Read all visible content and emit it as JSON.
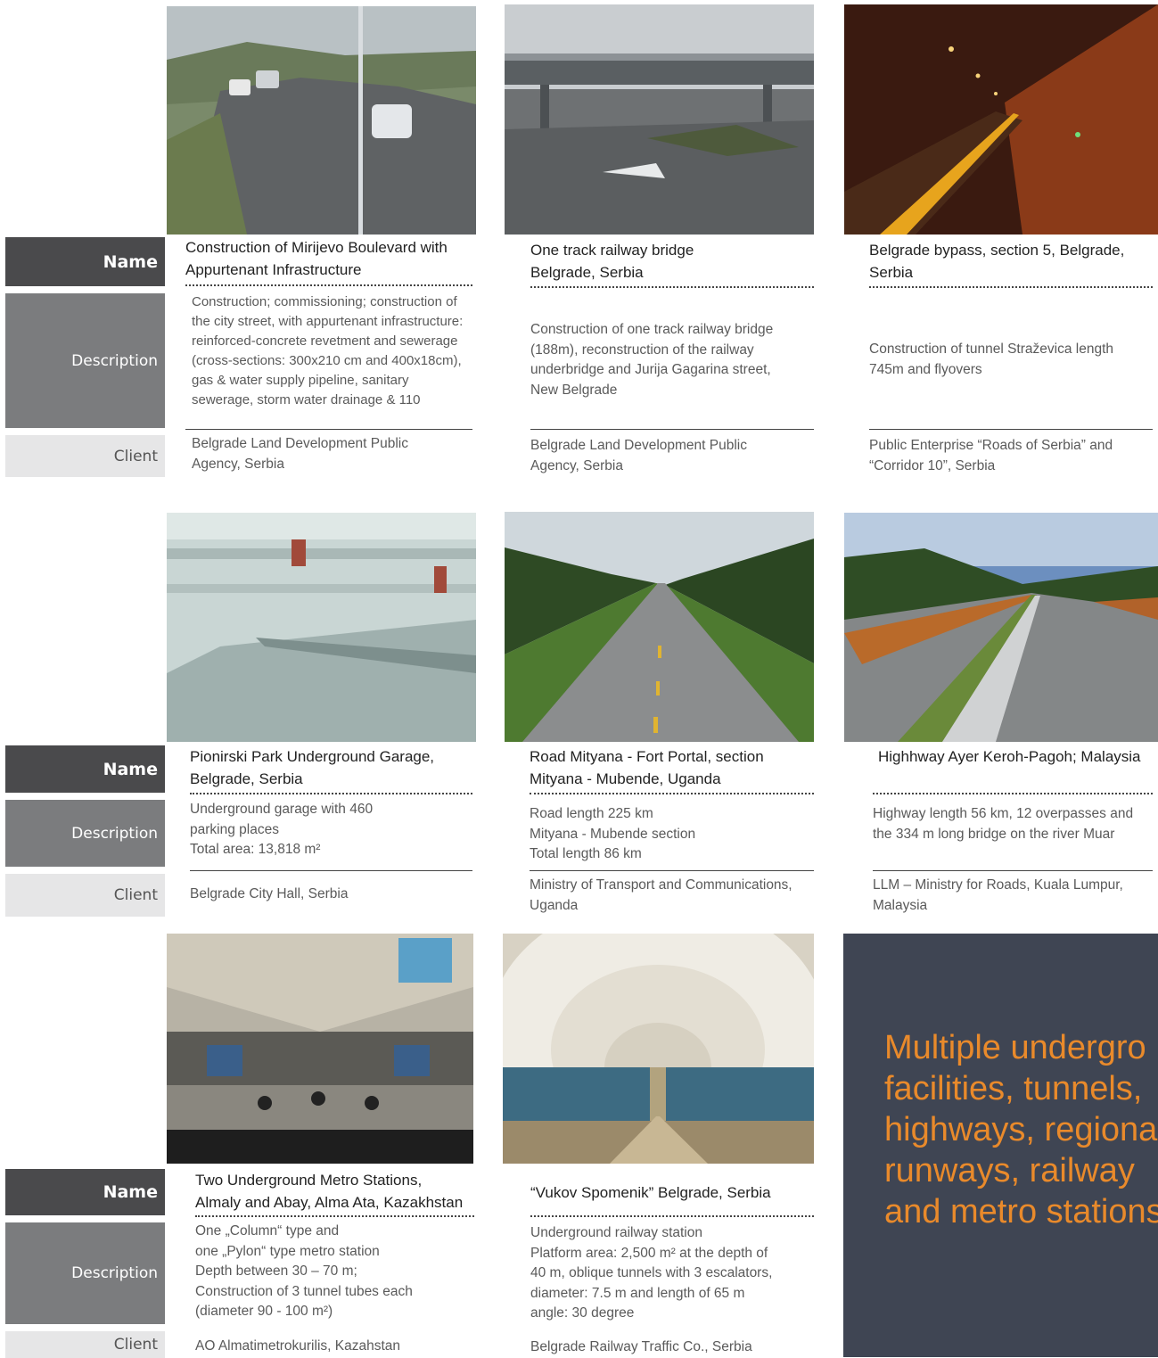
{
  "labels": {
    "name": "Name",
    "description": "Description",
    "client": "Client"
  },
  "projects": [
    {
      "image": "boulevard-photo",
      "name": "Construction of Mirijevo Boulevard with Appurtenant Infrastructure",
      "description": "Construction; commissioning; construction of the city street, with appurtenant infrastructure: reinforced-concrete revetment and sewerage (cross-sections: 300x210 cm and 400x18cm), gas & water supply pipeline, sanitary sewerage, storm water drainage & 110",
      "client": "Belgrade Land Development Public Agency, Serbia"
    },
    {
      "image": "railway-bridge-photo",
      "name": "One track railway bridge Belgrade, Serbia",
      "description": "Construction of one track railway bridge (188m), reconstruction of the railway underbridge and Jurija Gagarina street, New Belgrade",
      "client": "Belgrade Land Development Public Agency, Serbia"
    },
    {
      "image": "tunnel-photo",
      "name": "Belgrade bypass, section 5, Belgrade, Serbia",
      "description": "Construction of tunnel Straževica length 745m and flyovers",
      "client": "Public Enterprise “Roads of Serbia” and “Corridor 10”, Serbia"
    },
    {
      "image": "garage-photo",
      "name": "Pionirski Park Underground Garage, Belgrade, Serbia",
      "description": "Underground garage with 460 parking places",
      "description_area": "Total area: 13,818 m²",
      "client": "Belgrade City Hall, Serbia"
    },
    {
      "image": "uganda-road-photo",
      "name": "Road Mityana - Fort Portal, section Mityana - Mubende, Uganda",
      "description_lines": [
        "Road length 225 km",
        "Mityana - Mubende section",
        "Total length 86 km"
      ],
      "client": "Ministry of Transport and Communications, Uganda"
    },
    {
      "image": "malaysia-highway-photo",
      "name": "Highhway Ayer Keroh-Pagoh; Malaysia",
      "description": "Highway length 56 km, 12 overpasses and the 334 m long bridge on the river Muar",
      "client": "LLM – Ministry for Roads, Kuala Lumpur, Malaysia"
    },
    {
      "image": "almaty-metro-photo",
      "name": "Two Underground Metro Stations, Almaly and Abay, Alma Ata, Kazakhstan",
      "description_lines": [
        "One „Column“ type and",
        "one „Pylon“ type metro station",
        "Depth between 30 – 70 m;",
        "Construction of 3 tunnel tubes each",
        "(diameter  90 - 100 m²)"
      ],
      "client": "AO Almatimetrokurilis, Kazahstan"
    },
    {
      "image": "vukov-spomenik-photo",
      "name": "“Vukov Spomenik” Belgrade, Serbia",
      "description_lines": [
        "Underground railway station",
        "Platform area: 2,500 m² at the depth of",
        "40 m, oblique tunnels with 3 escalators,",
        "diameter: 7.5 m and length of 65 m",
        "angle: 30 degree"
      ],
      "client": "Belgrade Railway Traffic Co., Serbia"
    }
  ],
  "promo": {
    "lines": [
      "Multiple undergro",
      "facilities, tunnels,",
      "highways, regiona",
      "runways, railway",
      "and metro stations"
    ]
  },
  "colors": {
    "name_bg": "#4a4a4c",
    "desc_bg": "#7b7c7e",
    "client_bg": "#e6e6e7",
    "promo_bg": "#3f4553",
    "promo_text": "#e98a2b"
  }
}
